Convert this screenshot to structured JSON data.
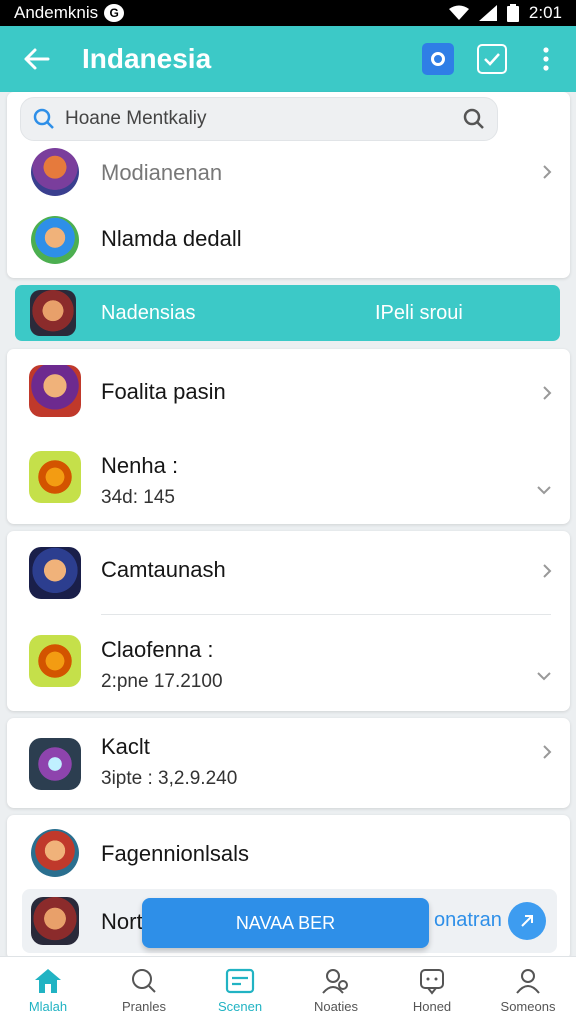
{
  "status_bar": {
    "left_text": "Andemknis",
    "time": "2:01"
  },
  "app_bar": {
    "title": "Indanesia"
  },
  "search": {
    "placeholder": "Hoane Mentkaliy"
  },
  "card1": {
    "items": [
      {
        "title": "Modianenan"
      },
      {
        "title": "Nlamda dedall"
      }
    ]
  },
  "highlight": {
    "label": "Nadensias",
    "right_label": "IPeli sroui"
  },
  "card2": {
    "items": [
      {
        "title": "Foalita pasin"
      },
      {
        "title": "Nenha :",
        "subtitle": "34d: 145"
      }
    ]
  },
  "card3": {
    "items": [
      {
        "title": "Camtaunash"
      },
      {
        "title": "Claofenna :",
        "subtitle": "2:pne 17.2100"
      }
    ]
  },
  "card4": {
    "items": [
      {
        "title": "Kaclt",
        "subtitle": "3ipte : 3,2.9.240"
      }
    ]
  },
  "card5": {
    "items": [
      {
        "title": "Fagennionlsals"
      },
      {
        "title": "Nort",
        "right_text": "onatran"
      }
    ]
  },
  "fab": {
    "label": "NAVAA BER"
  },
  "bottom_nav": {
    "items": [
      {
        "label": "Mlalah"
      },
      {
        "label": "Pranles"
      },
      {
        "label": "Scenen"
      },
      {
        "label": "Noaties"
      },
      {
        "label": "Honed"
      },
      {
        "label": "Someons"
      }
    ]
  },
  "colors": {
    "accent": "#3cc9c7",
    "primary_blue": "#2e8fe8",
    "nav_active": "#21b3c3"
  }
}
